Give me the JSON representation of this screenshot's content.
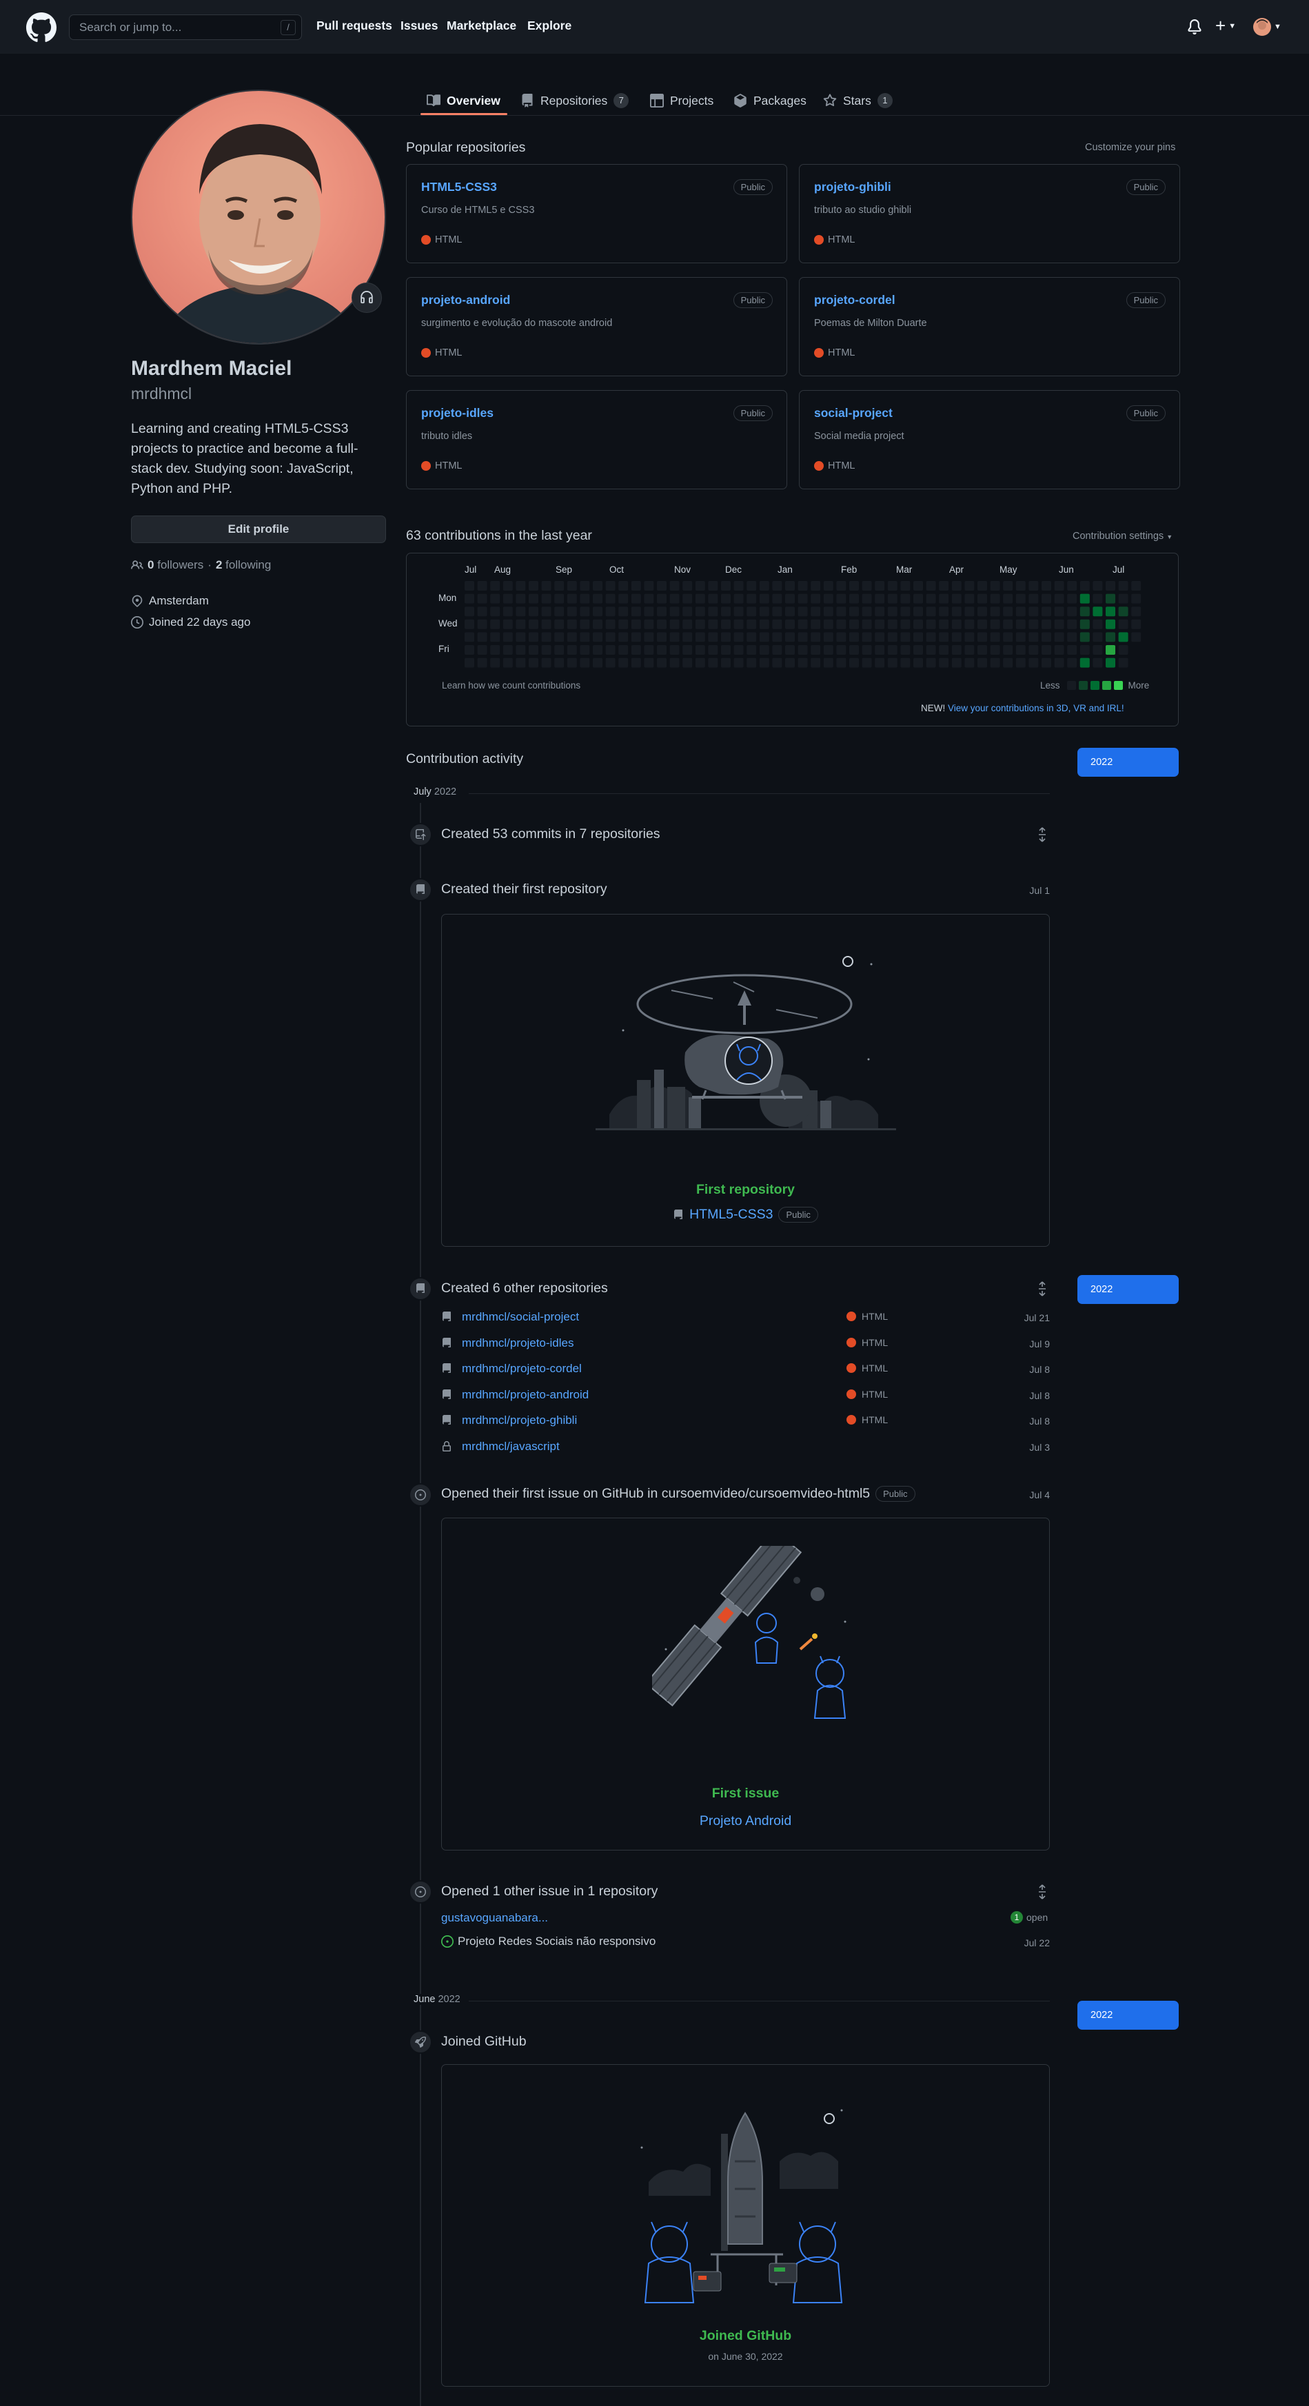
{
  "header": {
    "search_placeholder": "Search or jump to...",
    "search_key": "/",
    "nav": [
      "Pull requests",
      "Issues",
      "Marketplace",
      "Explore"
    ]
  },
  "tabs": [
    {
      "label": "Overview",
      "count": null
    },
    {
      "label": "Repositories",
      "count": "7"
    },
    {
      "label": "Projects",
      "count": null
    },
    {
      "label": "Packages",
      "count": null
    },
    {
      "label": "Stars",
      "count": "1"
    }
  ],
  "profile": {
    "name": "Mardhem Maciel",
    "username": "mrdhmcl",
    "bio": "Learning and creating HTML5-CSS3 projects to practice and become a full-stack dev. Studying soon: JavaScript, Python and PHP.",
    "edit_label": "Edit profile",
    "followers": "0",
    "followers_label": "followers",
    "following": "2",
    "following_label": "following",
    "location": "Amsterdam",
    "joined": "Joined 22 days ago"
  },
  "popular": {
    "title": "Popular repositories",
    "customize": "Customize your pins",
    "repos": [
      {
        "name": "HTML5-CSS3",
        "desc": "Curso de HTML5 e CSS3",
        "lang": "HTML",
        "visibility": "Public"
      },
      {
        "name": "projeto-ghibli",
        "desc": "tributo ao studio ghibli",
        "lang": "HTML",
        "visibility": "Public"
      },
      {
        "name": "projeto-android",
        "desc": "surgimento e evolução do mascote android",
        "lang": "HTML",
        "visibility": "Public"
      },
      {
        "name": "projeto-cordel",
        "desc": "Poemas de Milton Duarte",
        "lang": "HTML",
        "visibility": "Public"
      },
      {
        "name": "projeto-idles",
        "desc": "tributo idles",
        "lang": "HTML",
        "visibility": "Public"
      },
      {
        "name": "social-project",
        "desc": "Social media project",
        "lang": "HTML",
        "visibility": "Public"
      }
    ]
  },
  "contributions": {
    "title": "63 contributions in the last year",
    "settings": "Contribution settings",
    "months": [
      "Jul",
      "Aug",
      "Sep",
      "Oct",
      "Nov",
      "Dec",
      "Jan",
      "Feb",
      "Mar",
      "Apr",
      "May",
      "Jun",
      "Jul"
    ],
    "days": [
      "Mon",
      "Wed",
      "Fri"
    ],
    "learn": "Learn how we count contributions",
    "less": "Less",
    "more": "More",
    "new_label": "NEW!",
    "new_link": "View your contributions in 3D, VR and IRL!",
    "colors": [
      "#161b22",
      "#0e4429",
      "#006d32",
      "#26a641",
      "#39d353"
    ],
    "last_weeks_levels": [
      [
        0,
        2,
        1,
        1,
        1,
        0,
        2
      ],
      [
        0,
        0,
        2,
        0,
        0,
        0,
        0
      ],
      [
        0,
        1,
        2,
        2,
        1,
        3,
        2
      ],
      [
        0,
        0,
        1,
        0,
        2,
        0,
        0
      ],
      [
        0,
        0,
        0,
        0,
        0,
        0,
        0
      ]
    ]
  },
  "activity": {
    "title": "Contribution activity",
    "year": "2022",
    "month1": "July",
    "month1_year": "2022",
    "commits": "Created 53 commits in 7 repositories",
    "first_repo_title": "Created their first repository",
    "first_repo_date": "Jul 1",
    "first_repo_card_title": "First repository",
    "first_repo_card_name": "HTML5-CSS3",
    "first_repo_card_badge": "Public",
    "other_repos_title": "Created 6 other repositories",
    "other_repos": [
      {
        "name": "mrdhmcl/social-project",
        "lang": "HTML",
        "date": "Jul 21"
      },
      {
        "name": "mrdhmcl/projeto-idles",
        "lang": "HTML",
        "date": "Jul 9"
      },
      {
        "name": "mrdhmcl/projeto-cordel",
        "lang": "HTML",
        "date": "Jul 8"
      },
      {
        "name": "mrdhmcl/projeto-android",
        "lang": "HTML",
        "date": "Jul 8"
      },
      {
        "name": "mrdhmcl/projeto-ghibli",
        "lang": "HTML",
        "date": "Jul 8"
      },
      {
        "name": "mrdhmcl/javascript",
        "lang": "",
        "date": "Jul 3"
      }
    ],
    "issue_title": "Opened their first issue on GitHub in cursoemvideo/cursoemvideo-html5",
    "issue_badge": "Public",
    "issue_date": "Jul 4",
    "issue_card_title": "First issue",
    "issue_card_name": "Projeto Android",
    "other_issue_title": "Opened 1 other issue in 1 repository",
    "other_issue_repo": "gustavoguanabara...",
    "other_issue_count": "1",
    "other_issue_state": "open",
    "other_issue_name": "Projeto Redes Sociais não responsivo",
    "other_issue_date": "Jul 22",
    "month2": "June",
    "month2_year": "2022",
    "joined_title": "Joined GitHub",
    "joined_card_title": "Joined GitHub",
    "joined_card_date": "on June 30, 2022"
  }
}
